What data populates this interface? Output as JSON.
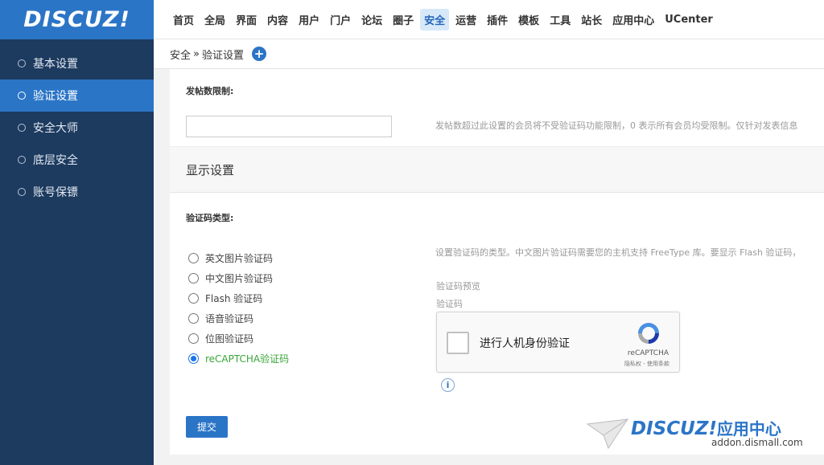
{
  "brand": {
    "logo_text": "DISCUZ!",
    "accent": "#2b75c7",
    "sidebar_bg": "#1d3a5f"
  },
  "topnav": [
    {
      "label": "首页",
      "active": false
    },
    {
      "label": "全局",
      "active": false
    },
    {
      "label": "界面",
      "active": false
    },
    {
      "label": "内容",
      "active": false
    },
    {
      "label": "用户",
      "active": false
    },
    {
      "label": "门户",
      "active": false
    },
    {
      "label": "论坛",
      "active": false
    },
    {
      "label": "圈子",
      "active": false
    },
    {
      "label": "安全",
      "active": true
    },
    {
      "label": "运营",
      "active": false
    },
    {
      "label": "插件",
      "active": false
    },
    {
      "label": "模板",
      "active": false
    },
    {
      "label": "工具",
      "active": false
    },
    {
      "label": "站长",
      "active": false
    },
    {
      "label": "应用中心",
      "active": false
    },
    {
      "label": "UCenter",
      "active": false
    }
  ],
  "sidebar": {
    "items": [
      {
        "label": "基本设置",
        "active": false
      },
      {
        "label": "验证设置",
        "active": true
      },
      {
        "label": "安全大师",
        "active": false
      },
      {
        "label": "底层安全",
        "active": false
      },
      {
        "label": "账号保镖",
        "active": false
      }
    ]
  },
  "breadcrumb": {
    "parent": "安全",
    "separator": "»",
    "current": "验证设置",
    "add_icon": "plus-icon"
  },
  "form": {
    "post_limit": {
      "label": "发帖数限制:",
      "value": "",
      "hint": "发帖数超过此设置的会员将不受验证码功能限制，0 表示所有会员均受限制。仅针对发表信息"
    },
    "section_title": "显示设置",
    "captcha_type": {
      "label": "验证码类型:",
      "hint": "设置验证码的类型。中文图片验证码需要您的主机支持 FreeType 库。要显示 Flash 验证码，",
      "options": [
        {
          "label": "英文图片验证码",
          "selected": false
        },
        {
          "label": "中文图片验证码",
          "selected": false
        },
        {
          "label": "Flash 验证码",
          "selected": false
        },
        {
          "label": "语音验证码",
          "selected": false
        },
        {
          "label": "位图验证码",
          "selected": false
        },
        {
          "label": "reCAPTCHA验证码",
          "selected": true
        }
      ],
      "preview_label": "验证码预览",
      "captcha_label": "验证码"
    },
    "recaptcha": {
      "checkbox_text": "进行人机身份验证",
      "brand": "reCAPTCHA",
      "links": "隐私权 - 使用条款"
    },
    "submit_label": "提交"
  },
  "watermark": {
    "brand": "DISCUZ!",
    "suffix": "应用中心",
    "url": "addon.dismall.com"
  }
}
